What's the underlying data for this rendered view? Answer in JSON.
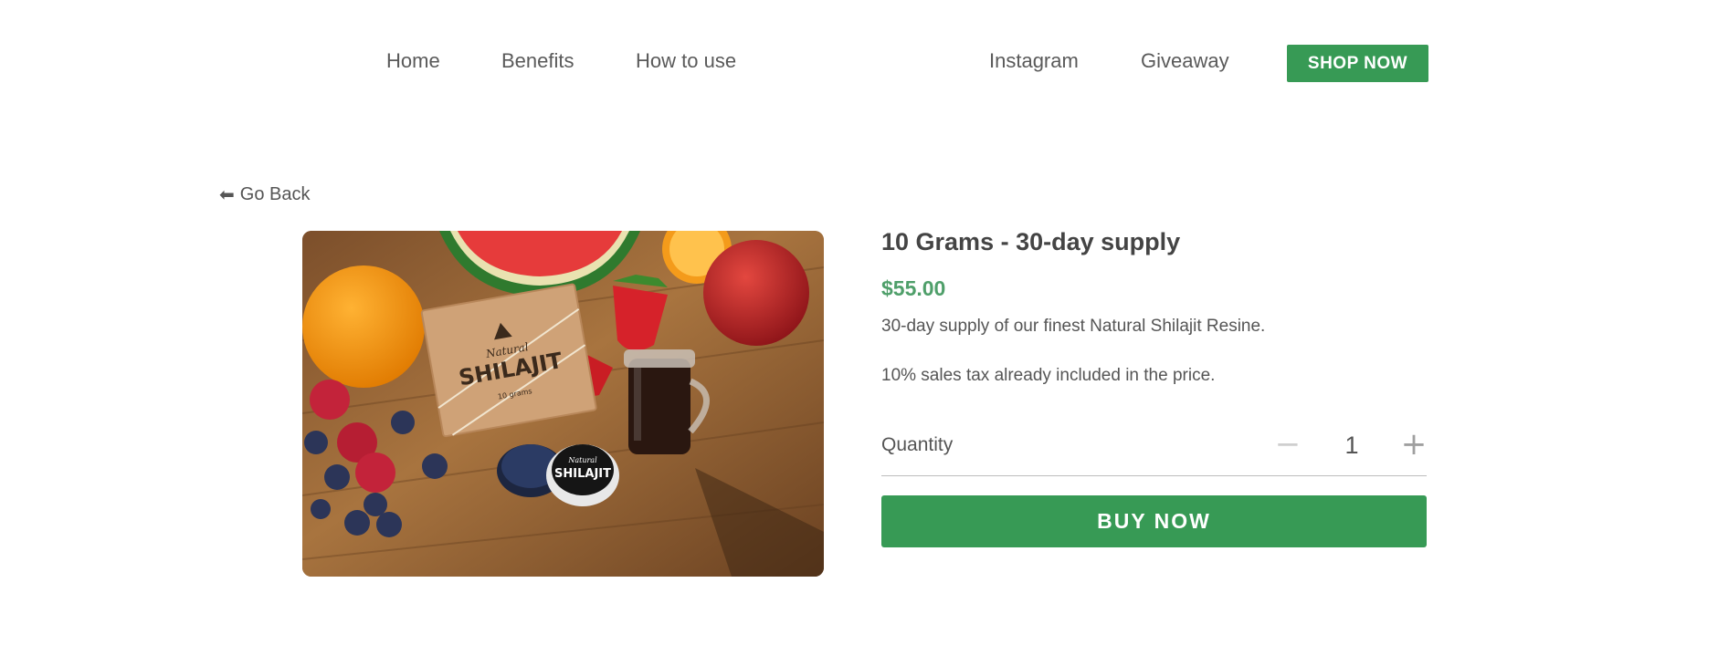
{
  "nav": {
    "left": [
      "Home",
      "Benefits",
      "How to use"
    ],
    "right": [
      "Instagram",
      "Giveaway"
    ],
    "cta_label": "SHOP NOW"
  },
  "back": {
    "label": "Go Back"
  },
  "image": {
    "alt": "Natural Shilajit box and jar with fruit",
    "box_brand": "Natural",
    "box_title": "SHILAJIT",
    "box_sub": "10 grams",
    "jar_brand": "Natural",
    "jar_title": "SHILAJIT"
  },
  "product": {
    "title": "10 Grams - 30-day supply",
    "price": "$55.00",
    "description": "30-day supply of our finest Natural Shilajit Resine.",
    "tax_note": "10% sales tax already included in the price.",
    "quantity_label": "Quantity",
    "quantity_value": "1",
    "buy_label": "BUY NOW"
  },
  "colors": {
    "accent_green": "#379a55",
    "price_green": "#4f9f6a"
  }
}
